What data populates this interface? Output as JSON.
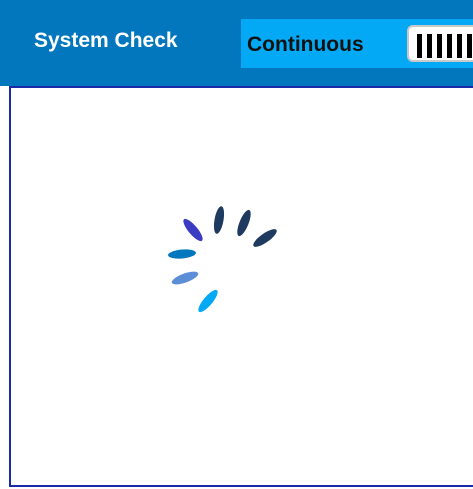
{
  "header": {
    "title": "System Check",
    "mode_label": "Continuous",
    "colors": {
      "header_bg": "#0277bd",
      "toggle_bg": "#03a9f4",
      "content_border": "#1a2aa8"
    }
  },
  "bars_button": {
    "icon": "bars-icon"
  },
  "spinner": {
    "icon": "loading-spinner-icon",
    "colors": [
      "#1e3a5f",
      "#1e3a5f",
      "#1e3a5f",
      "#3b3bc4",
      "#0277bd",
      "#5b8ed6",
      "#03a9f4"
    ]
  }
}
